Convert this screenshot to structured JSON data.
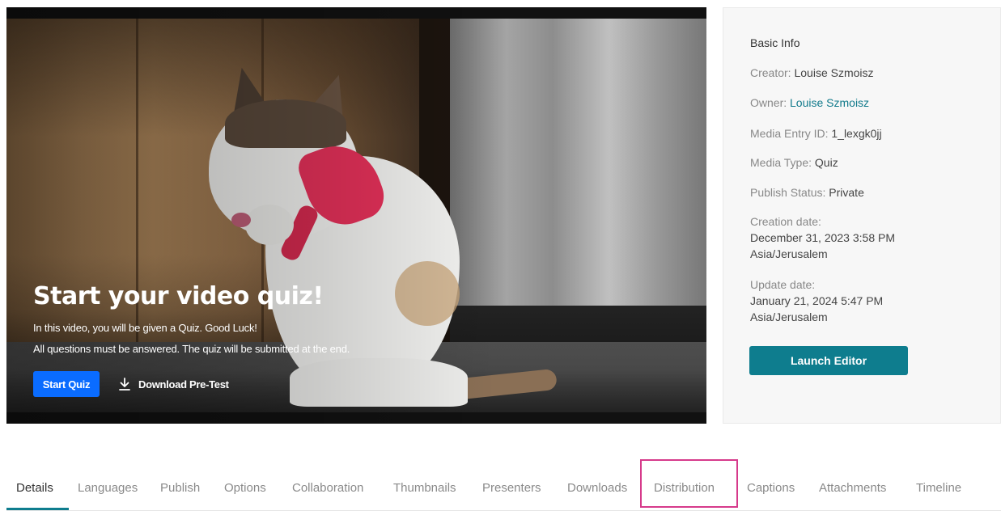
{
  "player": {
    "title": "Start your video quiz!",
    "line1": "In this video, you will be given a Quiz. Good Luck!",
    "line2": "All questions must be answered. The quiz will be submitted at the end.",
    "start_label": "Start Quiz",
    "download_label": "Download Pre-Test",
    "download_icon": "download-icon",
    "start_color": "#0a6cff"
  },
  "info": {
    "heading": "Basic Info",
    "creator_label": "Creator:",
    "creator_value": "Louise Szmoisz",
    "owner_label": "Owner:",
    "owner_value": "Louise Szmoisz",
    "entry_label": "Media Entry ID:",
    "entry_value": "1_lexgk0jj",
    "type_label": "Media Type:",
    "type_value": "Quiz",
    "status_label": "Publish Status:",
    "status_value": "Private",
    "creation_label": "Creation date:",
    "creation_value": "December 31, 2023 3:58 PM",
    "creation_tz": "Asia/Jerusalem",
    "update_label": "Update date:",
    "update_value": "January 21, 2024 5:47 PM",
    "update_tz": "Asia/Jerusalem",
    "launch_label": "Launch Editor",
    "accent_color": "#0e7d8e"
  },
  "tabs": [
    {
      "label": "Details",
      "active": true
    },
    {
      "label": "Languages"
    },
    {
      "label": "Publish"
    },
    {
      "label": "Options"
    },
    {
      "label": "Collaboration"
    },
    {
      "label": "Thumbnails"
    },
    {
      "label": "Presenters"
    },
    {
      "label": "Downloads"
    },
    {
      "label": "Distribution",
      "highlighted": true
    },
    {
      "label": "Captions"
    },
    {
      "label": "Attachments"
    },
    {
      "label": "Timeline"
    }
  ],
  "highlight_color": "#d63a8b"
}
